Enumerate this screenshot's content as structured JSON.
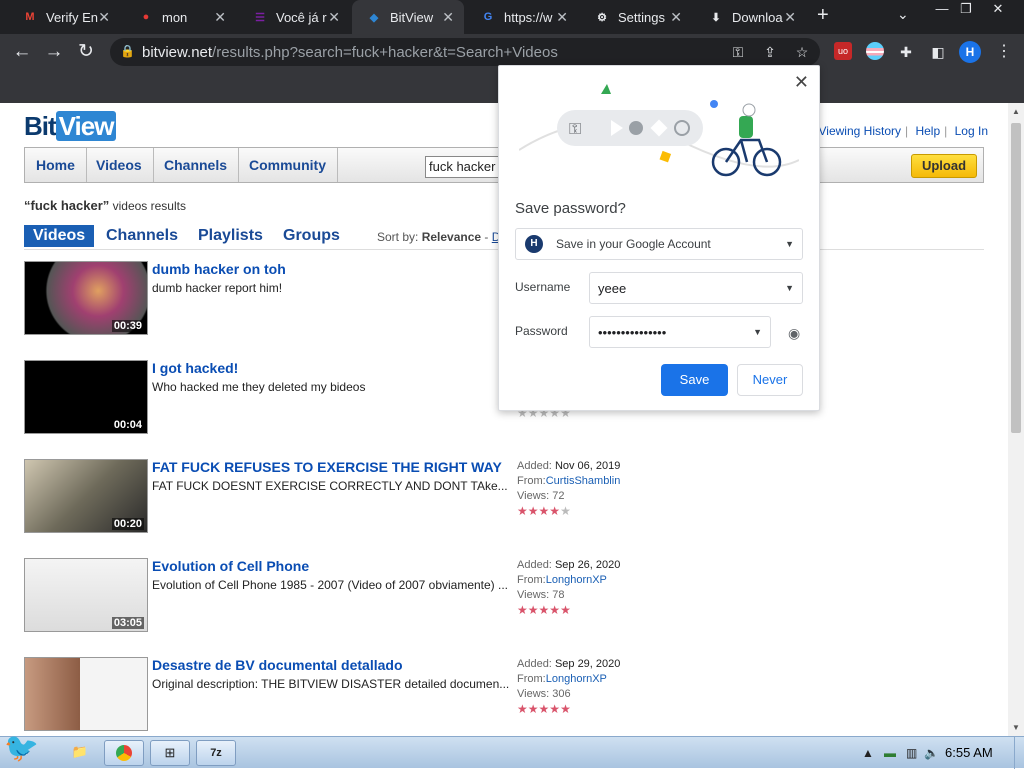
{
  "browser": {
    "tabs": [
      {
        "title": "Verify En",
        "favicon": "gmail-icon",
        "color": "#ea4335"
      },
      {
        "title": "mon",
        "favicon": "record-icon",
        "color": "#e53935"
      },
      {
        "title": "Você já r",
        "favicon": "list-icon",
        "color": "#7b1fa2"
      },
      {
        "title": "BitView",
        "favicon": "bitview-icon",
        "color": "#2e86d3",
        "active": true
      },
      {
        "title": "https://w",
        "favicon": "google-icon",
        "color": "#4285f4"
      },
      {
        "title": "Settings",
        "favicon": "gear-icon",
        "color": "#e8eaed"
      },
      {
        "title": "Downloa",
        "favicon": "download-icon",
        "color": "#e8eaed"
      }
    ],
    "new_tab": "+",
    "url_domain": "bitview.net",
    "url_path": "/results.php?search=fuck+hacker&t=Search+Videos",
    "profile_initial": "H"
  },
  "site": {
    "logo_part1": "Bit",
    "logo_part2": "View",
    "top_links": [
      "Viewing History",
      "Help",
      "Log In"
    ],
    "nav": [
      "Home",
      "Videos",
      "Channels",
      "Community"
    ],
    "search_value": "fuck hacker",
    "upload_label": "Upload",
    "results_query": "“fuck hacker”",
    "results_suffix": "videos results",
    "subtabs": [
      "Videos",
      "Channels",
      "Playlists",
      "Groups"
    ],
    "sort_label": "Sort by:",
    "sort_value": "Relevance",
    "sort_sep": "-",
    "sort_next": "D"
  },
  "results": [
    {
      "title": "dumb hacker on toh",
      "desc": "dumb hacker report him!",
      "duration": "00:39",
      "added": "",
      "from": "",
      "views": "",
      "rating": 0
    },
    {
      "title": "I got hacked!",
      "desc": "Who hacked me they deleted my bideos",
      "duration": "00:04",
      "added": "",
      "from": "",
      "views": "",
      "rating": 0
    },
    {
      "title": "FAT FUCK REFUSES TO EXERCISE THE RIGHT WAY",
      "desc": "FAT FUCK DOESNT EXERCISE CORRECTLY AND DONT TAke...",
      "duration": "00:20",
      "added": "Nov 06, 2019",
      "from": "CurtisShamblin",
      "views": "72",
      "rating": 4
    },
    {
      "title": "Evolution of Cell Phone",
      "desc": "Evolution of Cell Phone 1985 - 2007 (Video of 2007 obviamente) ...",
      "duration": "03:05",
      "added": "Sep 26, 2020",
      "from": "LonghornXP",
      "views": "78",
      "rating": 4.5
    },
    {
      "title": "Desastre de BV documental detallado",
      "desc": "Original description: THE BITVIEW DISASTER detailed documen...",
      "duration": "",
      "added": "Sep 29, 2020",
      "from": "LonghornXP",
      "views": "306",
      "rating": 5
    }
  ],
  "meta_labels": {
    "added": "Added:",
    "from": "From:",
    "views": "Views:"
  },
  "popup": {
    "title": "Save password?",
    "account_initial": "H",
    "account_label": "Save in your Google Account",
    "username_label": "Username",
    "username_value": "yeee",
    "password_label": "Password",
    "password_value": "•••••••••••••••",
    "save_label": "Save",
    "never_label": "Never"
  },
  "taskbar": {
    "clock": "6:55 AM"
  }
}
